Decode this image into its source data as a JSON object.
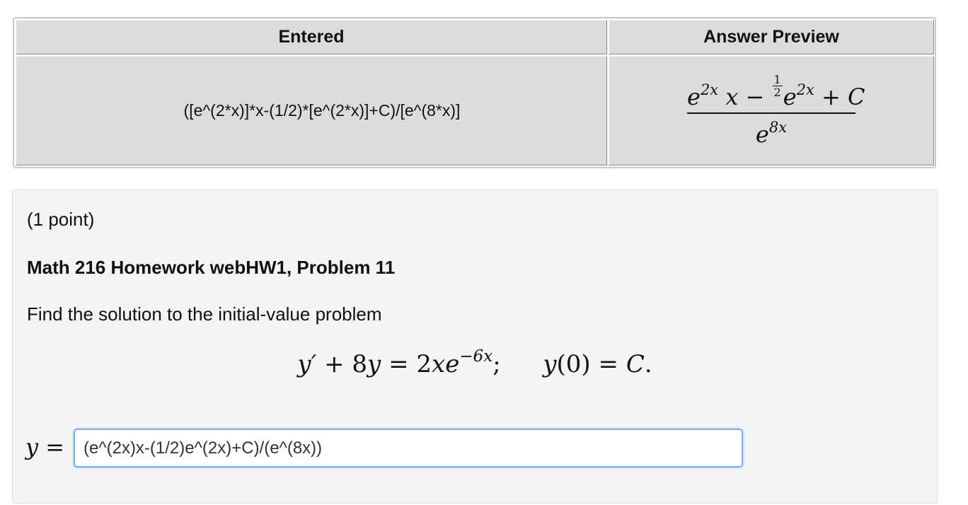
{
  "results_table": {
    "entered_header": "Entered",
    "preview_header": "Answer Preview",
    "entered_value": "([e^(2*x)]*x-(1/2)*[e^(2*x)]+C)/[e^(8*x)]",
    "preview": {
      "num_e1": "e",
      "num_exp1": "2x",
      "num_x": "x",
      "num_minus": "−",
      "half_num": "1",
      "half_den": "2",
      "num_e2": "e",
      "num_exp2": "2x",
      "num_plus": "+",
      "num_c": "C",
      "den_e": "e",
      "den_exp": "8x"
    }
  },
  "problem": {
    "points": "(1 point)",
    "title": "Math 216 Homework webHW1, Problem 11",
    "prompt": "Find the solution to the initial-value problem",
    "equation": {
      "lhs_y": "y′",
      "plus": "+ 8",
      "y2": "y",
      "eq": "= 2",
      "x": "x",
      "e": "e",
      "exp": "−6x",
      "semicolon": ";",
      "y0": "y",
      "arg": "(0) =",
      "c": "C",
      "period": "."
    },
    "answer_label_y": "y",
    "answer_label_eq": " =",
    "answer_value": "(e^(2x)x-(1/2)e^(2x)+C)/(e^(8x))"
  }
}
